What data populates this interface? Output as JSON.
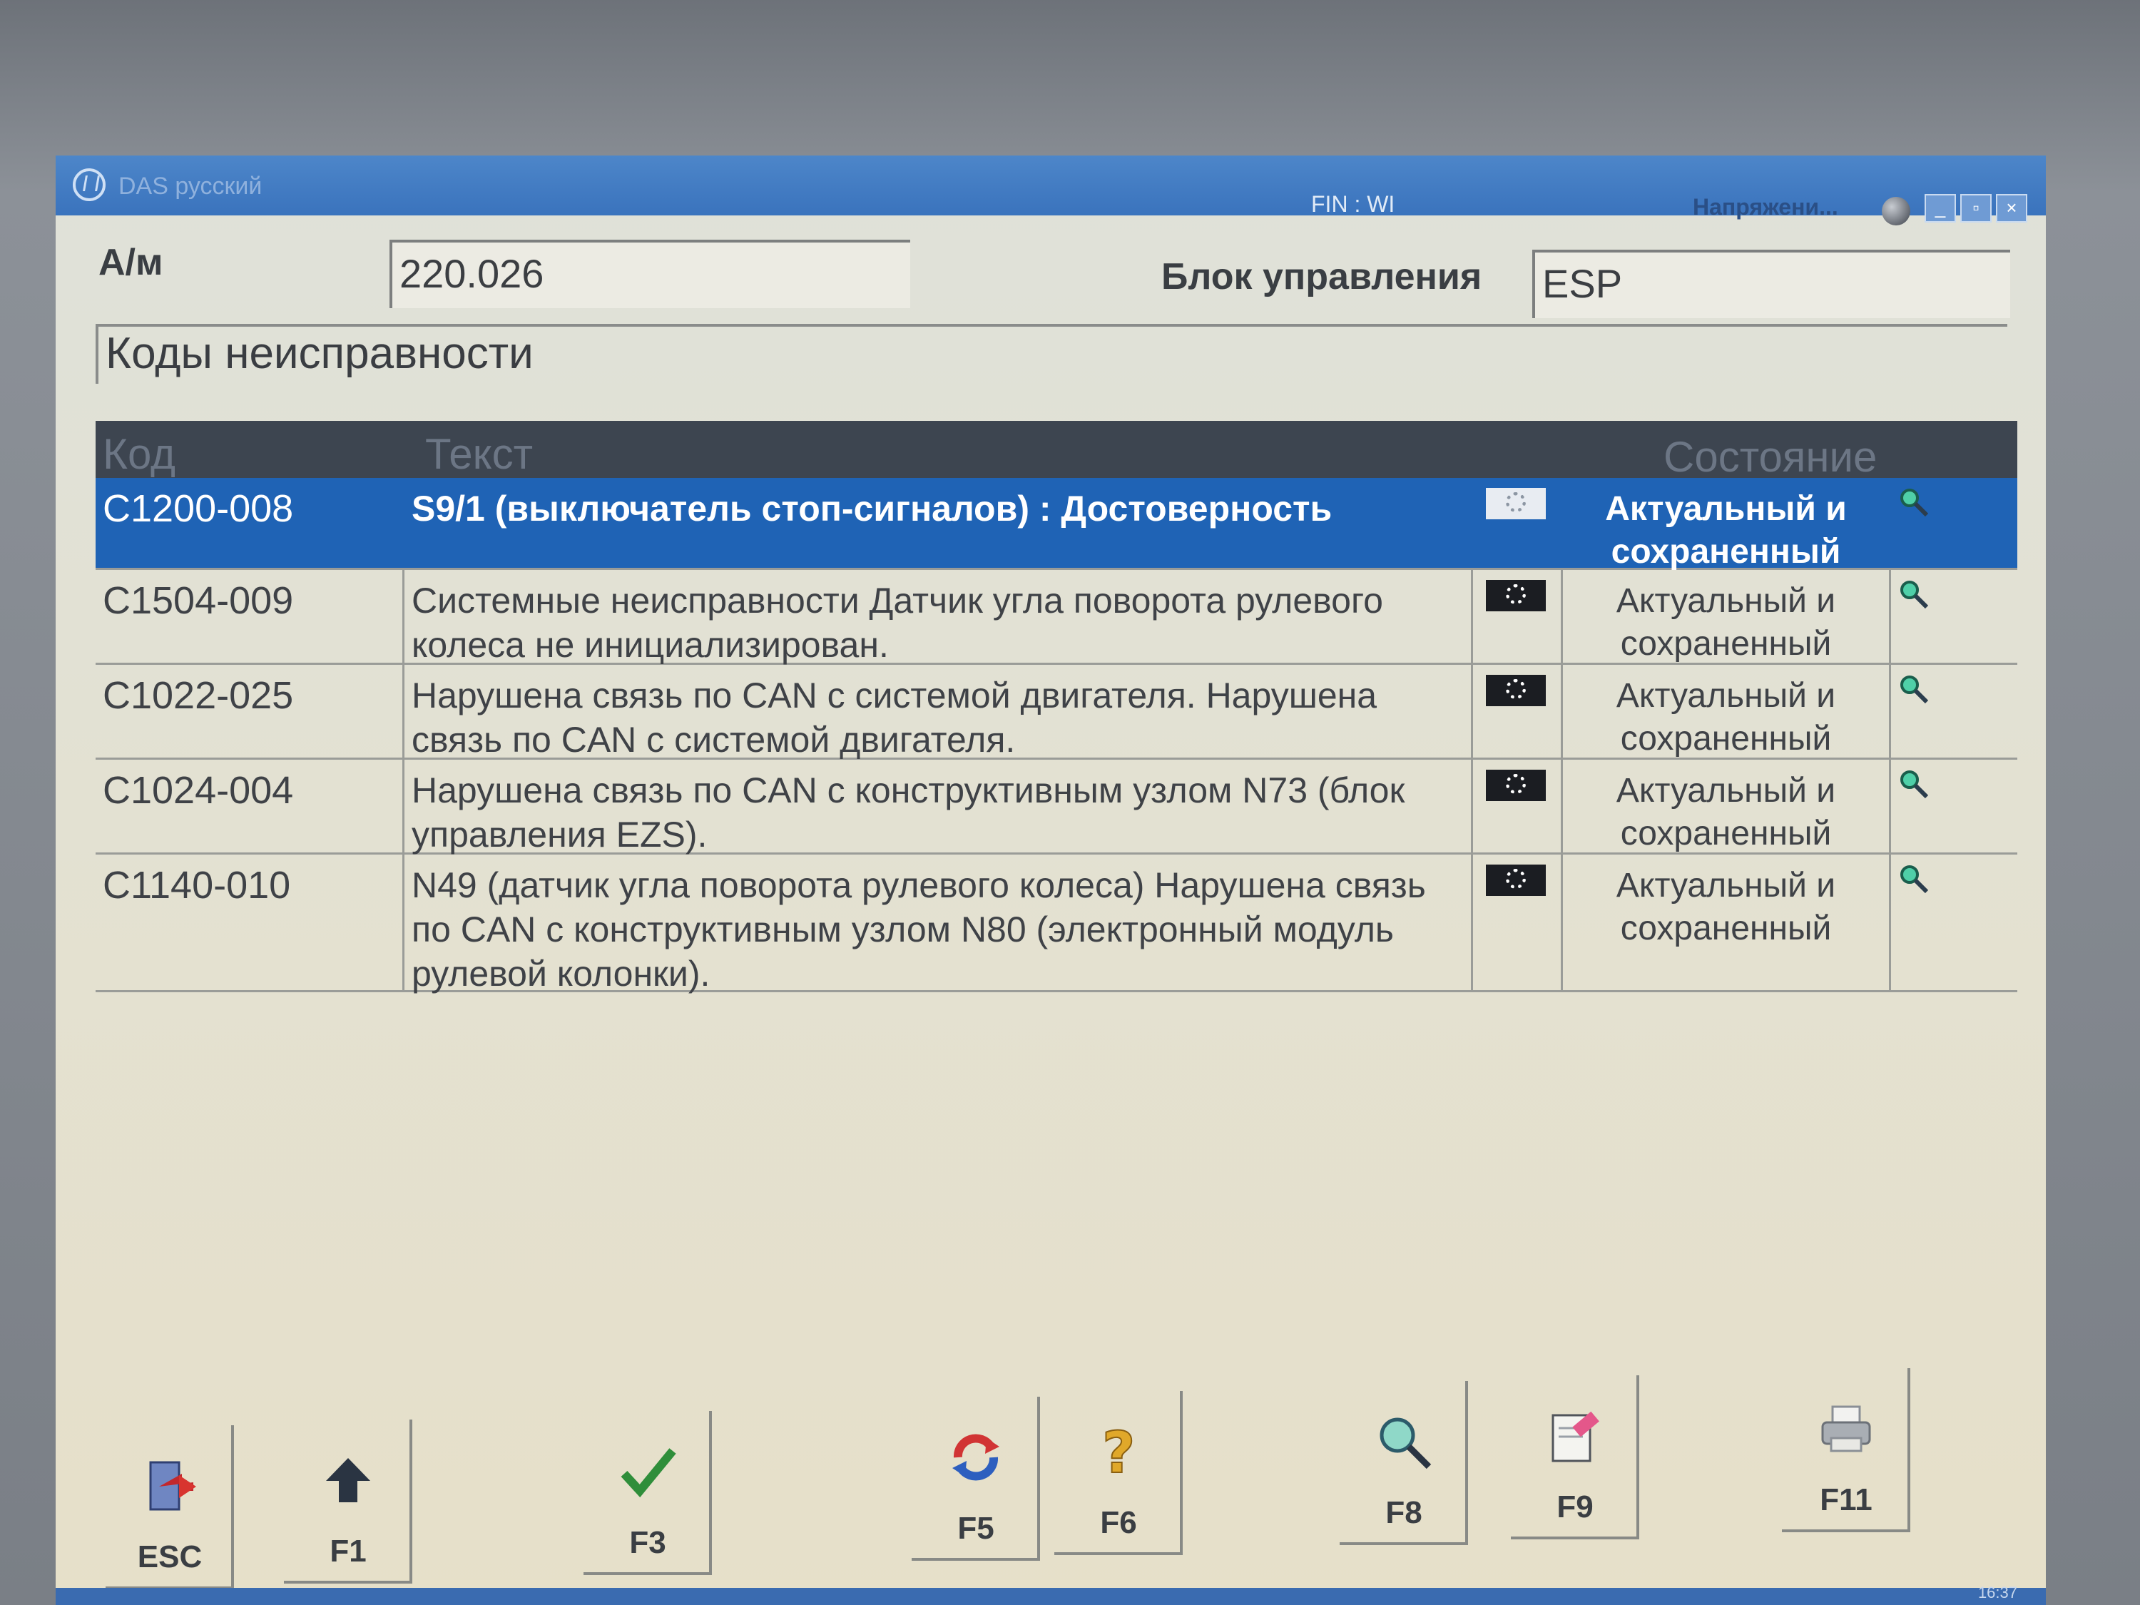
{
  "window": {
    "title": "DAS русский",
    "fin": "FIN : WI",
    "voltage": "Напряжени...",
    "minimize": "_",
    "restore": "▫",
    "close": "×"
  },
  "header": {
    "vehicle_label": "А/м",
    "vehicle_value": "220.026",
    "control_unit_label": "Блок управления",
    "control_unit_value": "ESP"
  },
  "section_title": "Коды неисправности",
  "table": {
    "columns": {
      "code": "Код",
      "text": "Текст",
      "state": "Состояние"
    },
    "rows": [
      {
        "code": "C1200-008",
        "text": "S9/1 (выключатель стоп-сигналов) : Достоверность",
        "state": "Актуальный и сохраненный",
        "selected": true
      },
      {
        "code": "C1504-009",
        "text": "Системные неисправности Датчик угла поворота рулевого колеса не инициализирован.",
        "state": "Актуальный и сохраненный",
        "selected": false
      },
      {
        "code": "C1022-025",
        "text": "Нарушена связь по CAN с системой двигателя. Нарушена связь по CAN с системой двигателя.",
        "state": "Актуальный и сохраненный",
        "selected": false
      },
      {
        "code": "C1024-004",
        "text": "Нарушена связь по CAN с конструктивным узлом N73 (блок управления EZS).",
        "state": "Актуальный и сохраненный",
        "selected": false
      },
      {
        "code": "C1140-010",
        "text": "N49 (датчик угла поворота рулевого колеса) Нарушена связь по CAN с конструктивным узлом N80 (электронный модуль рулевой колонки).",
        "state": "Актуальный и сохраненный",
        "selected": false
      }
    ]
  },
  "function_keys": {
    "esc": "ESC",
    "f1": "F1",
    "f3": "F3",
    "f5": "F5",
    "f6": "F6",
    "f8": "F8",
    "f9": "F9",
    "f11": "F11"
  },
  "taskbar": {
    "clock": "16:37"
  },
  "colors": {
    "selection": "#1f63b5",
    "titlebar": "#3a73bd",
    "header_row": "#3d4550"
  }
}
